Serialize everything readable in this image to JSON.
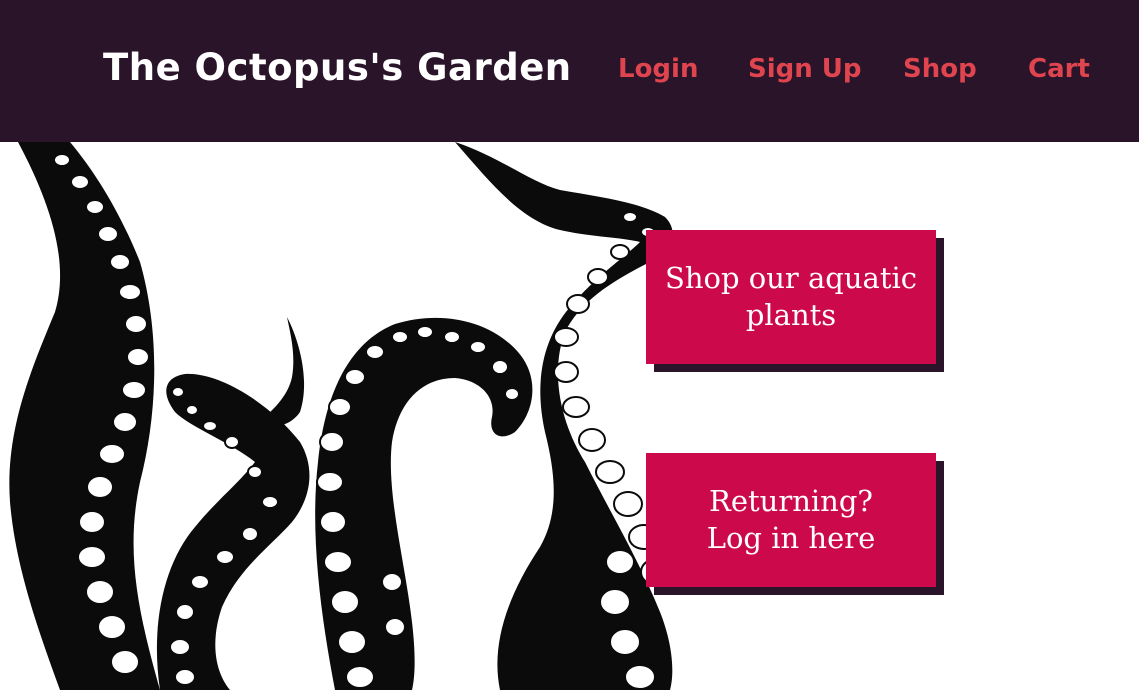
{
  "header": {
    "brand": "The Octopus's Garden",
    "nav": {
      "login": "Login",
      "signup": "Sign Up",
      "shop": "Shop",
      "cart": "Cart"
    }
  },
  "hero": {
    "illustration_icon": "octopus-tentacles-illustration",
    "cta_shop": {
      "line1": "Shop our aquatic",
      "line2": "plants"
    },
    "cta_login": {
      "line1": "Returning?",
      "line2": "Log in here"
    }
  },
  "colors": {
    "header_bg": "#29142a",
    "nav_link": "#e0454f",
    "cta_bg": "#cc0a4b",
    "cta_shadow": "#29142a",
    "ink": "#0b0b0b"
  }
}
